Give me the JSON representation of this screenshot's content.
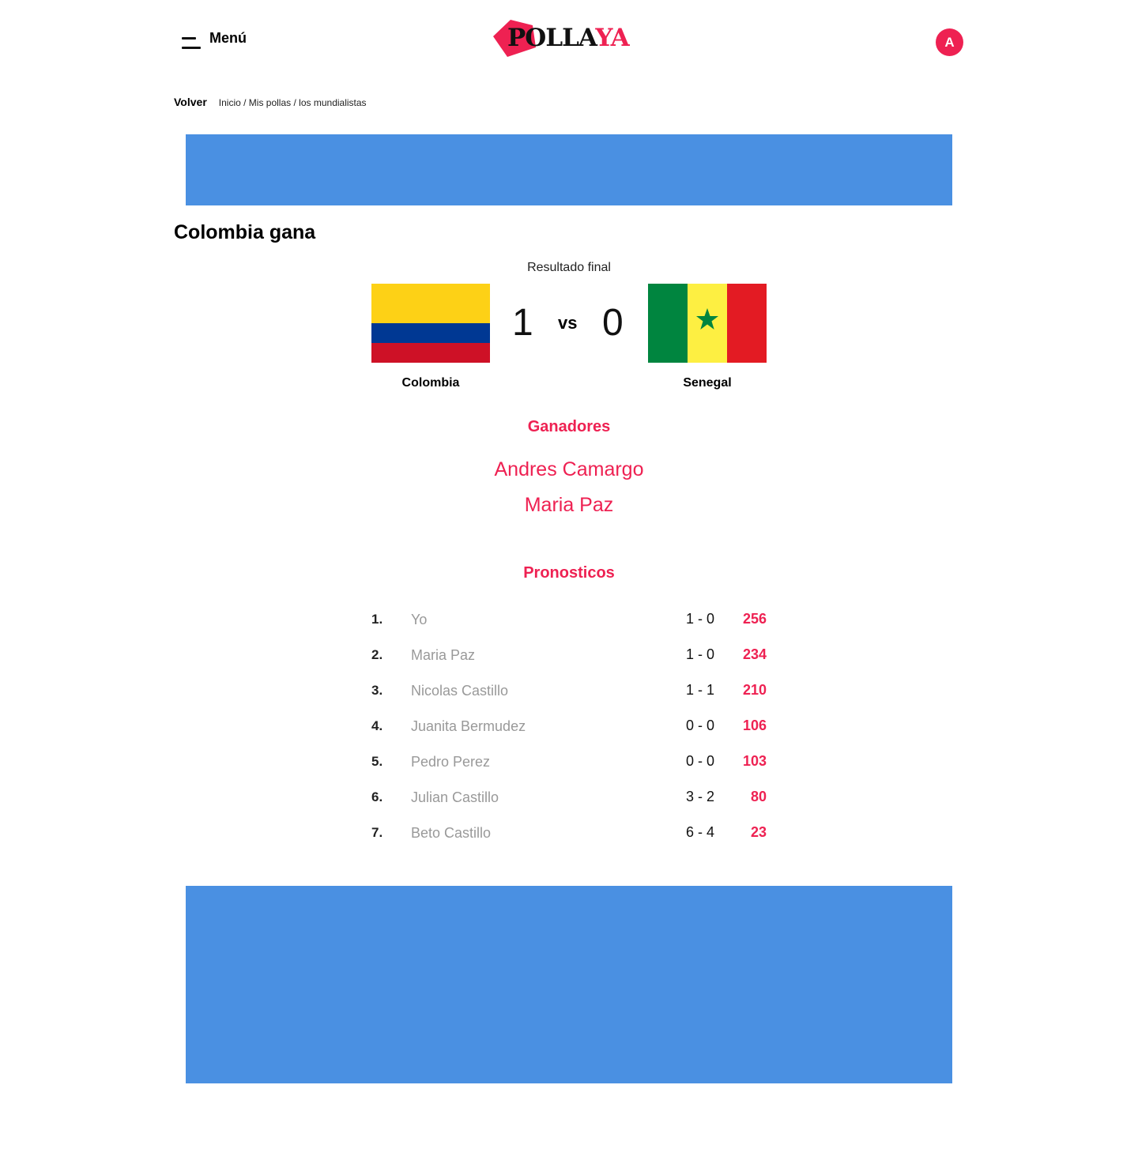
{
  "header": {
    "menu_label": "Menú",
    "logo_part1": "POLLA",
    "logo_part2": "YA",
    "avatar_initial": "A"
  },
  "breadcrumb": {
    "back_label": "Volver",
    "items": [
      "Inicio",
      "Mis pollas",
      "los mundialistas"
    ],
    "separator": " / "
  },
  "match": {
    "title": "Colombia gana",
    "status": "Resultado final",
    "home_team": "Colombia",
    "away_team": "Senegal",
    "home_score": "1",
    "away_score": "0",
    "vs_label": "vs"
  },
  "winners": {
    "title": "Ganadores",
    "names": [
      "Andres Camargo",
      "Maria Paz"
    ]
  },
  "predictions": {
    "title": "Pronosticos",
    "rows": [
      {
        "rank": "1.",
        "name": "Yo",
        "score": "1 - 0",
        "points": "256"
      },
      {
        "rank": "2.",
        "name": "Maria Paz",
        "score": "1 - 0",
        "points": "234"
      },
      {
        "rank": "3.",
        "name": "Nicolas Castillo",
        "score": "1 - 1",
        "points": "210"
      },
      {
        "rank": "4.",
        "name": "Juanita Bermudez",
        "score": "0 - 0",
        "points": "106"
      },
      {
        "rank": "5.",
        "name": "Pedro Perez",
        "score": "0 - 0",
        "points": "103"
      },
      {
        "rank": "6.",
        "name": "Julian Castillo",
        "score": "3 - 2",
        "points": "80"
      },
      {
        "rank": "7.",
        "name": "Beto Castillo",
        "score": "6 - 4",
        "points": "23"
      }
    ]
  },
  "colors": {
    "accent": "#ee2152",
    "ad_banner": "#4a90e2",
    "muted_text": "#999999"
  },
  "icons": {
    "menu": "hamburger-icon",
    "flag_home": "colombia-flag",
    "flag_away": "senegal-flag"
  }
}
